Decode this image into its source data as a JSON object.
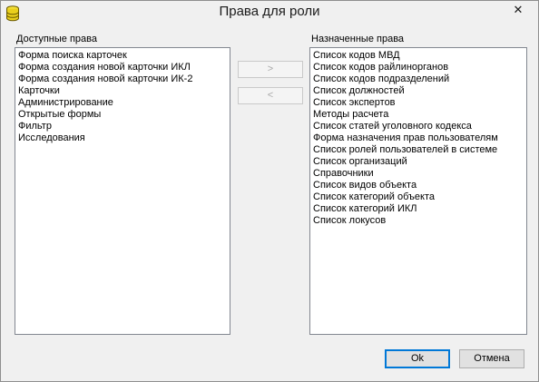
{
  "window": {
    "title": "Права для роли",
    "close_glyph": "✕"
  },
  "available": {
    "label": "Доступные права",
    "items": [
      "Форма поиска карточек",
      "Форма создания новой карточки ИКЛ",
      "Форма создания новой карточки ИК-2",
      "Карточки",
      "Администрирование",
      "Открытые формы",
      "Фильтр",
      "Исследования"
    ]
  },
  "assigned": {
    "label": "Назначенные права",
    "items": [
      "Список кодов МВД",
      "Список кодов райлинорганов",
      "Список кодов подразделений",
      "Список должностей",
      "Список экспертов",
      "Методы расчета",
      "Список статей уголовного кодекса",
      " Форма назначения прав пользователям",
      "Список ролей пользователей в системе",
      "Список организаций",
      "Справочники",
      "Список видов объекта",
      "Список категорий объекта",
      "Список категорий ИКЛ",
      "Список локусов"
    ]
  },
  "transfer": {
    "add_label": ">",
    "remove_label": "<"
  },
  "footer": {
    "ok_label": "Ok",
    "cancel_label": "Отмена"
  },
  "colors": {
    "window_bg": "#f0f0f0",
    "list_bg": "#ffffff",
    "default_button_border": "#0078d7",
    "disabled_text": "#a8a8a8"
  }
}
